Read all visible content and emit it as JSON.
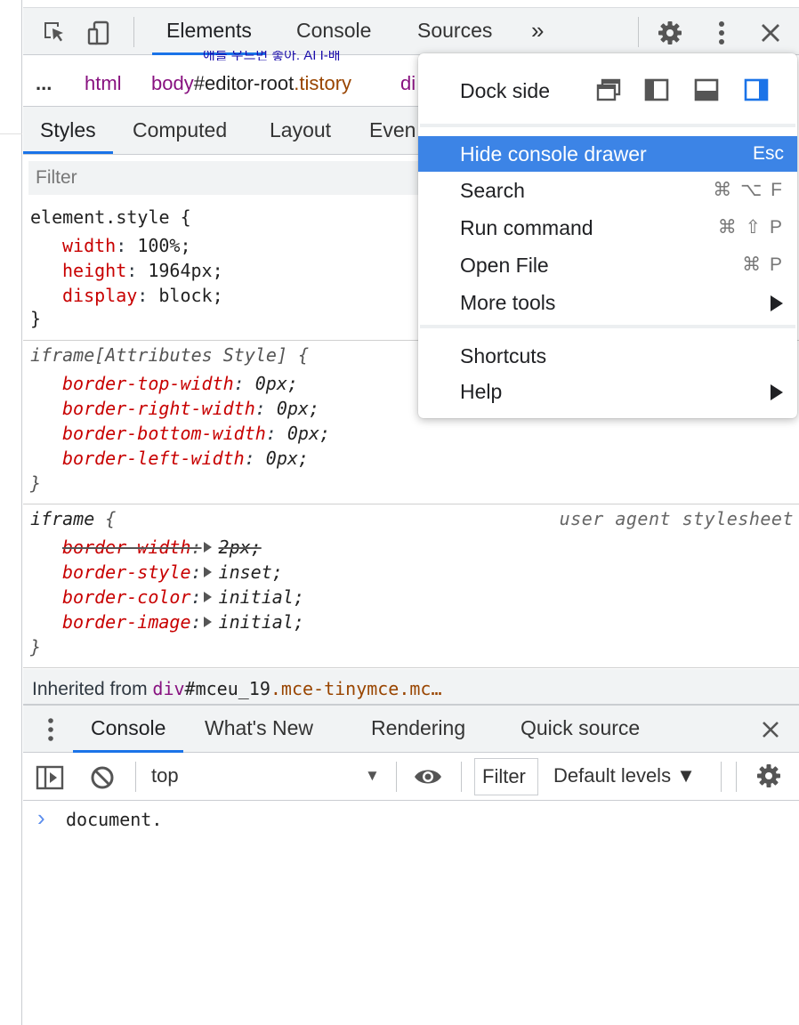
{
  "toolbar": {
    "tabs": [
      "Elements",
      "Console",
      "Sources"
    ],
    "more": "»"
  },
  "ghost_text": "애를 우드먼 좋아. AI I-배",
  "breadcrumbs": {
    "ellipsis": "...",
    "items": [
      {
        "tag": "html",
        "rest": "",
        "cls": ""
      },
      {
        "tag": "body",
        "rest": "#editor-root",
        "cls": ".tistory"
      },
      {
        "tag": "di",
        "rest": "",
        "cls": ""
      }
    ]
  },
  "styles_tabs": [
    "Styles",
    "Computed",
    "Layout",
    "Even"
  ],
  "styles_filter": {
    "placeholder": "Filter",
    "value": ""
  },
  "rules": {
    "element_style": {
      "selector": "element.style {",
      "decls": [
        {
          "prop": "width",
          "val": "100%;"
        },
        {
          "prop": "height",
          "val": "1964px;"
        },
        {
          "prop": "display",
          "val": "block;"
        }
      ],
      "close": "}"
    },
    "iframe_attr": {
      "selector": "iframe[Attributes Style] {",
      "decls": [
        {
          "prop": "border-top-width",
          "val": "0px;"
        },
        {
          "prop": "border-right-width",
          "val": "0px;"
        },
        {
          "prop": "border-bottom-width",
          "val": "0px;"
        },
        {
          "prop": "border-left-width",
          "val": "0px;"
        }
      ],
      "close": "}"
    },
    "iframe_ua": {
      "selector": "iframe",
      "brace": "{",
      "source": "user agent stylesheet",
      "decls": [
        {
          "prop": "border-width",
          "val": "2px;"
        },
        {
          "prop": "border-style",
          "val": "inset;"
        },
        {
          "prop": "border-color",
          "val": "initial;"
        },
        {
          "prop": "border-image",
          "val": "initial;"
        }
      ],
      "close": "}"
    }
  },
  "inherited": {
    "label": "Inherited from",
    "tag": "div",
    "id": "#mceu_19",
    "cls": ".mce-tinymce.mc…"
  },
  "drawer": {
    "tabs": [
      "Console",
      "What's New",
      "Rendering",
      "Quick source"
    ]
  },
  "console_toolbar": {
    "context": "top",
    "filter_placeholder": "Filter",
    "levels": "Default levels ▼"
  },
  "console": {
    "prompt": "›",
    "input": "document."
  },
  "menu": {
    "dock_side": "Dock side",
    "items": [
      {
        "label": "Hide console drawer",
        "shortcut": "Esc",
        "highlighted": true
      },
      {
        "label": "Search",
        "shortcut": "⌘ ⌥ F"
      },
      {
        "label": "Run command",
        "shortcut": "⌘ ⇧ P"
      },
      {
        "label": "Open File",
        "shortcut": "⌘ P"
      },
      {
        "label": "More tools",
        "shortcut": ""
      }
    ],
    "items2": [
      {
        "label": "Shortcuts"
      },
      {
        "label": "Help"
      }
    ]
  },
  "colors": {
    "accent": "#1a73e8",
    "menu_highlight": "#3c84e6",
    "prop": "#c80000",
    "tag": "#881280",
    "attr": "#994500"
  }
}
